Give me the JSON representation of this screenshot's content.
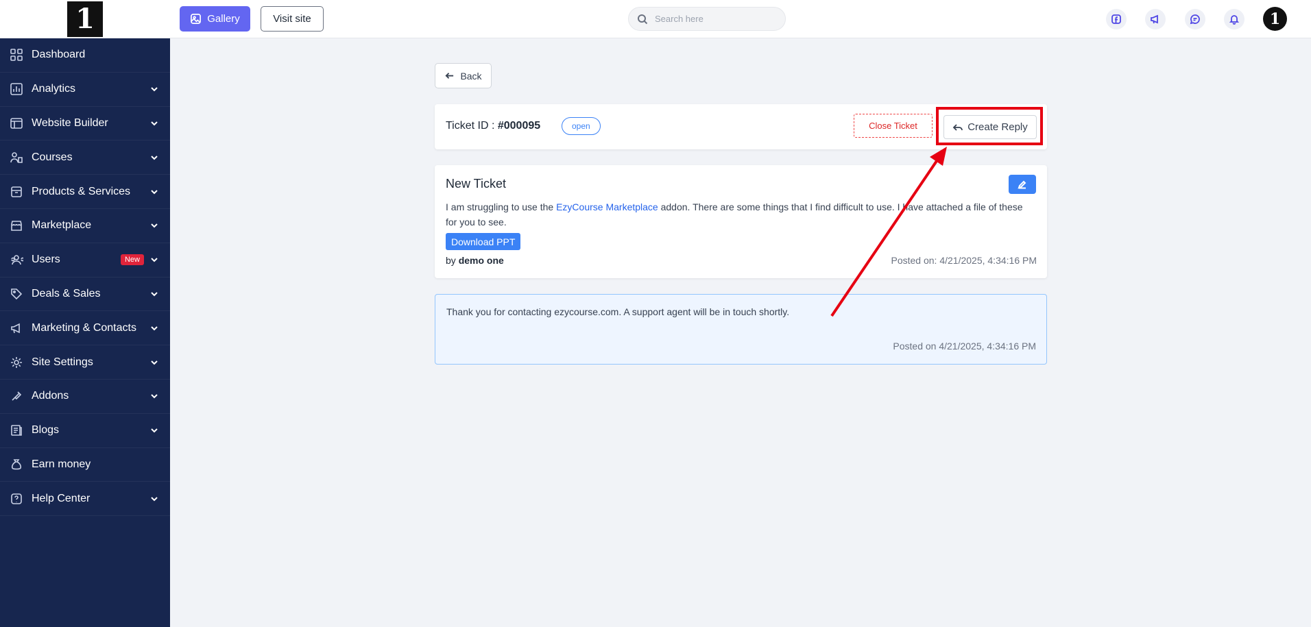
{
  "logo": {
    "glyph": "1"
  },
  "sidebar": {
    "items": [
      {
        "label": "Dashboard",
        "icon": "dashboard-icon",
        "has_chevron": false
      },
      {
        "label": "Analytics",
        "icon": "analytics-icon",
        "has_chevron": true
      },
      {
        "label": "Website Builder",
        "icon": "website-builder-icon",
        "has_chevron": true
      },
      {
        "label": "Courses",
        "icon": "courses-icon",
        "has_chevron": true
      },
      {
        "label": "Products & Services",
        "icon": "products-icon",
        "has_chevron": true
      },
      {
        "label": "Marketplace",
        "icon": "marketplace-icon",
        "has_chevron": true
      },
      {
        "label": "Users",
        "icon": "users-icon",
        "has_chevron": true,
        "badge": "New"
      },
      {
        "label": "Deals & Sales",
        "icon": "tag-icon",
        "has_chevron": true
      },
      {
        "label": "Marketing & Contacts",
        "icon": "megaphone-icon",
        "has_chevron": true
      },
      {
        "label": "Site Settings",
        "icon": "settings-icon",
        "has_chevron": true
      },
      {
        "label": "Addons",
        "icon": "addons-icon",
        "has_chevron": true
      },
      {
        "label": "Blogs",
        "icon": "blogs-icon",
        "has_chevron": true
      },
      {
        "label": "Earn money",
        "icon": "money-bag-icon",
        "has_chevron": false
      },
      {
        "label": "Help Center",
        "icon": "help-icon",
        "has_chevron": true
      }
    ]
  },
  "topbar": {
    "gallery_label": "Gallery",
    "visit_site_label": "Visit site",
    "search_placeholder": "Search here",
    "avatar_glyph": "1",
    "icons": [
      "facebook-icon",
      "megaphone-icon",
      "chat-icon",
      "bell-icon"
    ]
  },
  "main": {
    "back_label": "Back",
    "ticket": {
      "id_label": "Ticket ID : ",
      "id_value": "#000095",
      "status": "open",
      "close_label": "Close Ticket",
      "reply_label": "Create Reply"
    },
    "ticket_card": {
      "title": "New Ticket",
      "body_before_link": "I am struggling to use the ",
      "link_text": "EzyCourse Marketplace",
      "body_after_link": " addon. There are some things that I find difficult to use. I have attached a file of these for you to see.",
      "download_label": "Download PPT",
      "by_prefix": "by ",
      "author": "demo one",
      "posted": "Posted on: 4/21/2025, 4:34:16 PM"
    },
    "reply_card": {
      "text": "Thank you for contacting ezycourse.com. A support agent will be in touch shortly.",
      "posted": "Posted on 4/21/2025, 4:34:16 PM"
    }
  },
  "colors": {
    "sidebar_bg": "#17264f",
    "accent": "#6366f1",
    "primary_blue": "#3b82f6",
    "danger": "#dc2626",
    "annotation_red": "#e60012"
  }
}
